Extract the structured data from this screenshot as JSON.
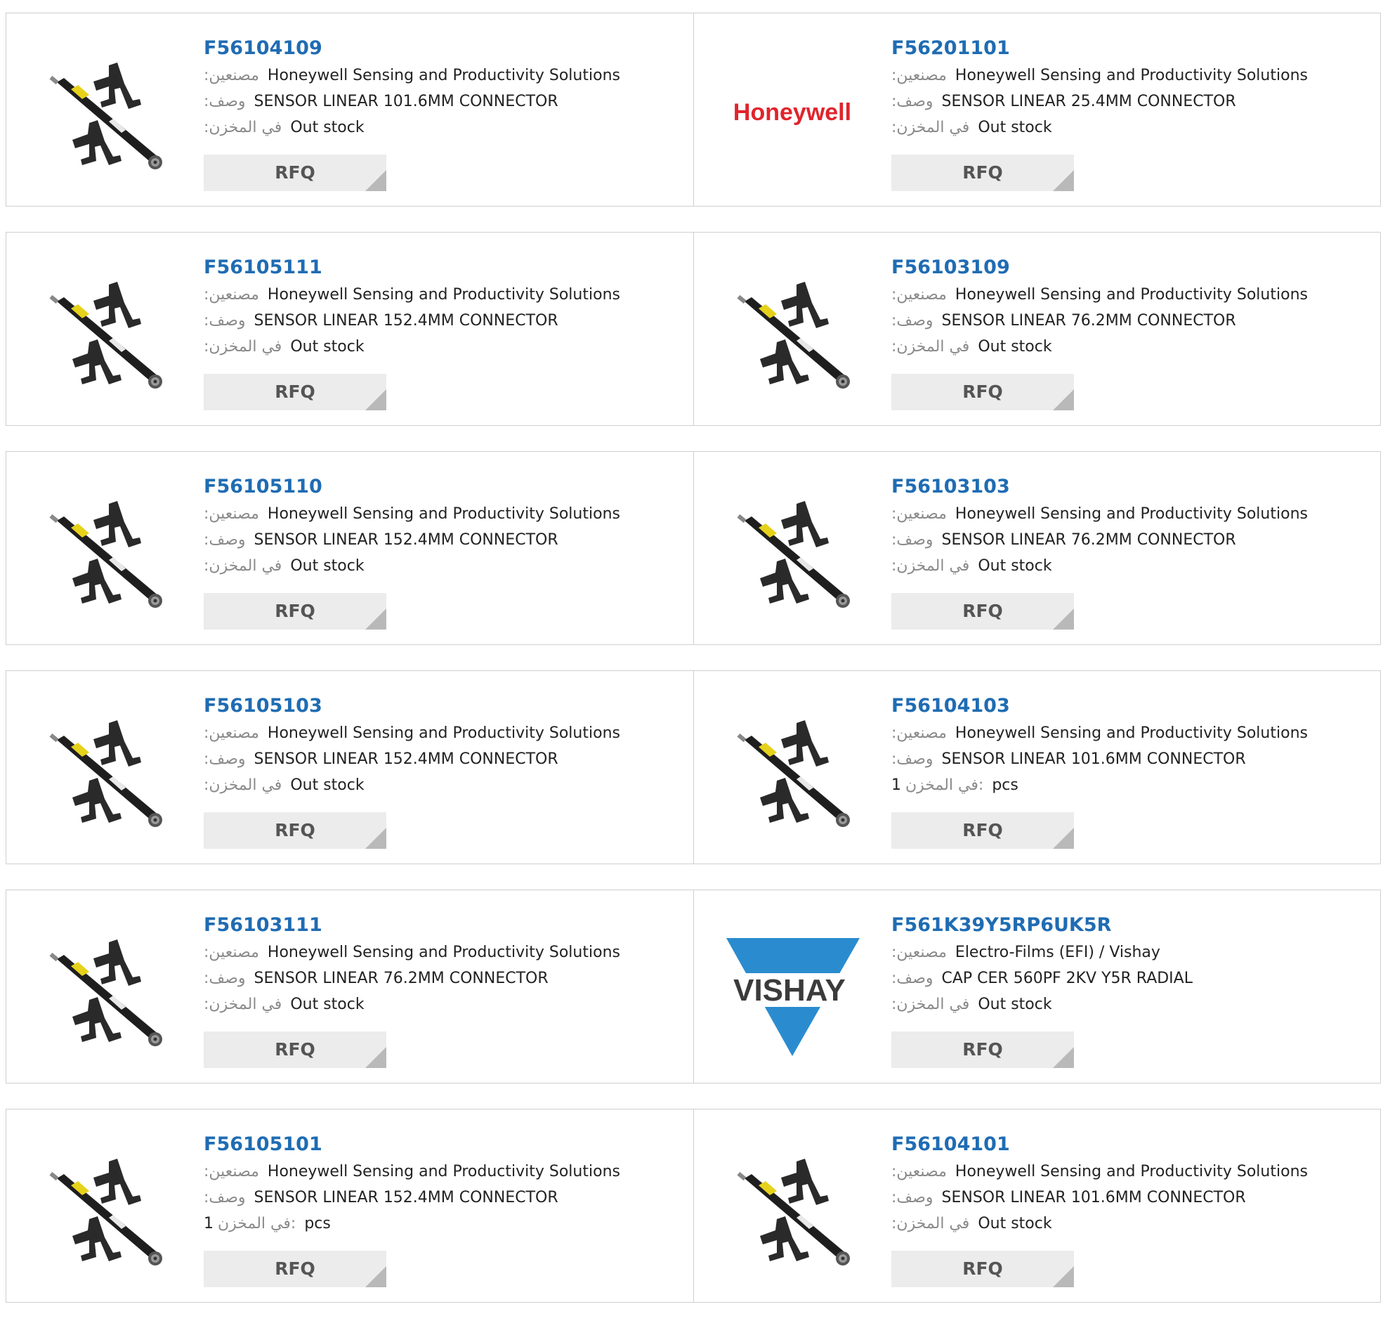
{
  "labels": {
    "manufacturer": ":مصنعين",
    "description": ":وصف",
    "stock": ":في المخزن",
    "stock_qty": "في المخزن:",
    "rfq": "RFQ"
  },
  "products": [
    {
      "part": "F56104109",
      "manufacturer": "Honeywell Sensing and Productivity Solutions",
      "description": "SENSOR LINEAR 101.6MM CONNECTOR",
      "stock": "Out stock",
      "image": "sensor"
    },
    {
      "part": "F56201101",
      "manufacturer": "Honeywell Sensing and Productivity Solutions",
      "description": "SENSOR LINEAR 25.4MM CONNECTOR",
      "stock": "Out stock",
      "image": "honeywell-logo",
      "logo_text": "Honeywell"
    },
    {
      "part": "F56105111",
      "manufacturer": "Honeywell Sensing and Productivity Solutions",
      "description": "SENSOR LINEAR 152.4MM CONNECTOR",
      "stock": "Out stock",
      "image": "sensor"
    },
    {
      "part": "F56103109",
      "manufacturer": "Honeywell Sensing and Productivity Solutions",
      "description": "SENSOR LINEAR 76.2MM CONNECTOR",
      "stock": "Out stock",
      "image": "sensor"
    },
    {
      "part": "F56105110",
      "manufacturer": "Honeywell Sensing and Productivity Solutions",
      "description": "SENSOR LINEAR 152.4MM CONNECTOR",
      "stock": "Out stock",
      "image": "sensor"
    },
    {
      "part": "F56103103",
      "manufacturer": "Honeywell Sensing and Productivity Solutions",
      "description": "SENSOR LINEAR 76.2MM CONNECTOR",
      "stock": "Out stock",
      "image": "sensor"
    },
    {
      "part": "F56105103",
      "manufacturer": "Honeywell Sensing and Productivity Solutions",
      "description": "SENSOR LINEAR 152.4MM CONNECTOR",
      "stock": "Out stock",
      "image": "sensor"
    },
    {
      "part": "F56104103",
      "manufacturer": "Honeywell Sensing and Productivity Solutions",
      "description": "SENSOR LINEAR 101.6MM CONNECTOR",
      "stock_qty": "1",
      "stock_unit": "pcs",
      "image": "sensor"
    },
    {
      "part": "F56103111",
      "manufacturer": "Honeywell Sensing and Productivity Solutions",
      "description": "SENSOR LINEAR 76.2MM CONNECTOR",
      "stock": "Out stock",
      "image": "sensor"
    },
    {
      "part": "F561K39Y5RP6UK5R",
      "manufacturer": "Electro-Films (EFI) / Vishay",
      "description": "CAP CER 560PF 2KV Y5R RADIAL",
      "stock": "Out stock",
      "image": "vishay-logo",
      "logo_text": "VISHAY"
    },
    {
      "part": "F56105101",
      "manufacturer": "Honeywell Sensing and Productivity Solutions",
      "description": "SENSOR LINEAR 152.4MM CONNECTOR",
      "stock_qty": "1",
      "stock_unit": "pcs",
      "image": "sensor"
    },
    {
      "part": "F56104101",
      "manufacturer": "Honeywell Sensing and Productivity Solutions",
      "description": "SENSOR LINEAR 101.6MM CONNECTOR",
      "stock": "Out stock",
      "image": "sensor"
    }
  ],
  "colors": {
    "link": "#1f6cb3",
    "honeywell_red": "#e0242c",
    "vishay_blue": "#2a8ccf"
  }
}
